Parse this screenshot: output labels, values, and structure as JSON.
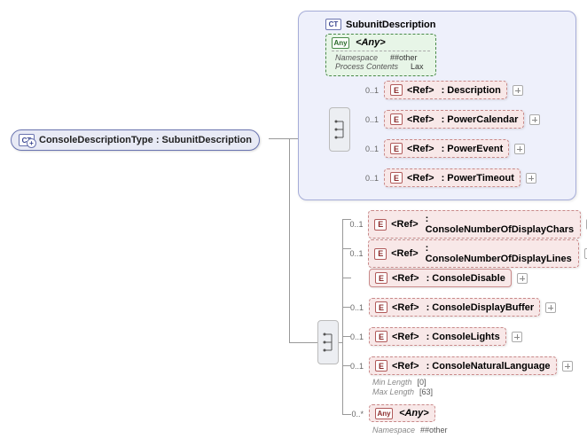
{
  "badges": {
    "ct": "CT",
    "e": "E",
    "any": "Any"
  },
  "root": {
    "label": "ConsoleDescriptionType : SubunitDescription"
  },
  "subunit_group": {
    "title": "SubunitDescription",
    "any_block": {
      "label": "<Any>",
      "meta": [
        {
          "key": "Namespace",
          "value": "##other"
        },
        {
          "key": "Process Contents",
          "value": "Lax"
        }
      ]
    },
    "items": [
      {
        "occ": "0..1",
        "ref": "<Ref>",
        "type": ": Description"
      },
      {
        "occ": "0..1",
        "ref": "<Ref>",
        "type": ": PowerCalendar"
      },
      {
        "occ": "0..1",
        "ref": "<Ref>",
        "type": ": PowerEvent"
      },
      {
        "occ": "0..1",
        "ref": "<Ref>",
        "type": ": PowerTimeout"
      }
    ]
  },
  "console_items": [
    {
      "occ": "0..1",
      "ref": "<Ref>",
      "type": ": ConsoleNumberOfDisplayChars",
      "solid": false
    },
    {
      "occ": "0..1",
      "ref": "<Ref>",
      "type": ": ConsoleNumberOfDisplayLines",
      "solid": false
    },
    {
      "occ": "",
      "ref": "<Ref>",
      "type": ": ConsoleDisable",
      "solid": true
    },
    {
      "occ": "0..1",
      "ref": "<Ref>",
      "type": ": ConsoleDisplayBuffer",
      "solid": false
    },
    {
      "occ": "0..1",
      "ref": "<Ref>",
      "type": ": ConsoleLights",
      "solid": false
    },
    {
      "occ": "0..1",
      "ref": "<Ref>",
      "type": ": ConsoleNaturalLanguage",
      "solid": false,
      "meta": [
        {
          "key": "Min Length",
          "value": "[0]"
        },
        {
          "key": "Max Length",
          "value": "[63]"
        }
      ]
    }
  ],
  "bottom_any": {
    "occ": "0..*",
    "label": "<Any>",
    "meta": [
      {
        "key": "Namespace",
        "value": "##other"
      }
    ]
  }
}
